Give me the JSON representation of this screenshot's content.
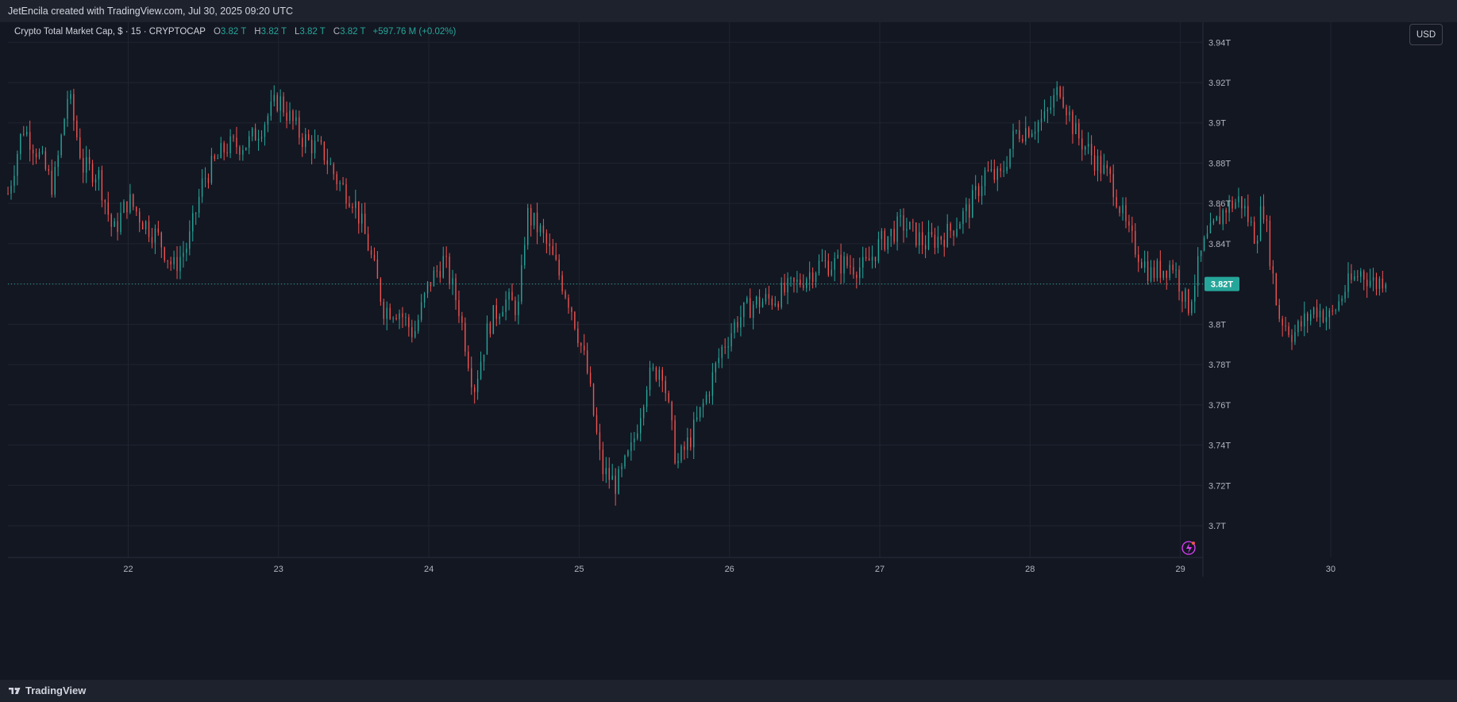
{
  "header": {
    "credit": "JetEncila created with TradingView.com, Jul 30, 2025 09:20 UTC"
  },
  "legend": {
    "symbol": "Crypto Total Market Cap, $ · 15 · CRYPTOCAP",
    "open_label": "O",
    "open": "3.82 T",
    "high_label": "H",
    "high": "3.82 T",
    "low_label": "L",
    "low": "3.82 T",
    "close_label": "C",
    "close": "3.82 T",
    "change": "+597.76 M (+0.02%)"
  },
  "toolbar": {
    "currency": "USD"
  },
  "footer": {
    "brand": "TradingView"
  },
  "icons": {
    "brand_logo": "tradingview-logo-icon",
    "replay": "lightning-icon"
  },
  "colors": {
    "up": "#26a69a",
    "down": "#ef5350",
    "background": "#131722",
    "price_label": "#26a69a",
    "grid": "#1f2430"
  },
  "chart_data": {
    "type": "candlestick",
    "title": "Crypto Total Market Cap",
    "interval": "15",
    "exchange": "CRYPTOCAP",
    "unit": "T",
    "x_ticks": [
      "22",
      "23",
      "24",
      "25",
      "26",
      "27",
      "28",
      "29",
      "30"
    ],
    "y_ticks": [
      3.7,
      3.72,
      3.74,
      3.76,
      3.78,
      3.8,
      3.82,
      3.84,
      3.86,
      3.88,
      3.9,
      3.92,
      3.94
    ],
    "y_tick_labels": [
      "3.7T",
      "3.72T",
      "3.74T",
      "3.76T",
      "3.78T",
      "3.8T",
      "3.82T",
      "3.84T",
      "3.86T",
      "3.88T",
      "3.9T",
      "3.92T",
      "3.94T"
    ],
    "ylim": [
      3.685,
      3.945
    ],
    "xlim_days": [
      21.2,
      30.5
    ],
    "current_price": 3.82,
    "current_price_label": "3.82T",
    "grid": true,
    "series_path": [
      [
        21.2,
        3.865
      ],
      [
        21.3,
        3.898
      ],
      [
        21.4,
        3.885
      ],
      [
        21.5,
        3.868
      ],
      [
        21.55,
        3.89
      ],
      [
        21.6,
        3.915
      ],
      [
        21.7,
        3.878
      ],
      [
        21.8,
        3.875
      ],
      [
        21.9,
        3.845
      ],
      [
        22.0,
        3.862
      ],
      [
        22.1,
        3.851
      ],
      [
        22.2,
        3.843
      ],
      [
        22.3,
        3.828
      ],
      [
        22.4,
        3.84
      ],
      [
        22.5,
        3.872
      ],
      [
        22.65,
        3.888
      ],
      [
        22.8,
        3.89
      ],
      [
        22.9,
        3.9
      ],
      [
        23.0,
        3.912
      ],
      [
        23.15,
        3.893
      ],
      [
        23.3,
        3.885
      ],
      [
        23.4,
        3.87
      ],
      [
        23.5,
        3.862
      ],
      [
        23.6,
        3.838
      ],
      [
        23.7,
        3.808
      ],
      [
        23.8,
        3.807
      ],
      [
        23.9,
        3.795
      ],
      [
        24.0,
        3.82
      ],
      [
        24.1,
        3.832
      ],
      [
        24.2,
        3.808
      ],
      [
        24.3,
        3.768
      ],
      [
        24.4,
        3.8
      ],
      [
        24.5,
        3.812
      ],
      [
        24.6,
        3.808
      ],
      [
        24.65,
        3.855
      ],
      [
        24.75,
        3.845
      ],
      [
        24.85,
        3.828
      ],
      [
        24.95,
        3.808
      ],
      [
        25.05,
        3.778
      ],
      [
        25.15,
        3.728
      ],
      [
        25.25,
        3.72
      ],
      [
        25.35,
        3.738
      ],
      [
        25.45,
        3.772
      ],
      [
        25.55,
        3.78
      ],
      [
        25.65,
        3.73
      ],
      [
        25.75,
        3.745
      ],
      [
        25.85,
        3.765
      ],
      [
        25.95,
        3.788
      ],
      [
        26.05,
        3.802
      ],
      [
        26.15,
        3.81
      ],
      [
        26.3,
        3.813
      ],
      [
        26.45,
        3.82
      ],
      [
        26.6,
        3.83
      ],
      [
        26.75,
        3.83
      ],
      [
        26.9,
        3.828
      ],
      [
        27.0,
        3.84
      ],
      [
        27.15,
        3.85
      ],
      [
        27.3,
        3.84
      ],
      [
        27.45,
        3.845
      ],
      [
        27.6,
        3.858
      ],
      [
        27.7,
        3.875
      ],
      [
        27.8,
        3.872
      ],
      [
        27.9,
        3.895
      ],
      [
        28.0,
        3.898
      ],
      [
        28.1,
        3.902
      ],
      [
        28.2,
        3.918
      ],
      [
        28.3,
        3.895
      ],
      [
        28.45,
        3.88
      ],
      [
        28.55,
        3.87
      ],
      [
        28.65,
        3.845
      ],
      [
        28.8,
        3.825
      ],
      [
        28.95,
        3.83
      ],
      [
        29.05,
        3.808
      ],
      [
        29.15,
        3.838
      ],
      [
        29.3,
        3.858
      ],
      [
        29.4,
        3.862
      ],
      [
        29.5,
        3.843
      ],
      [
        29.55,
        3.86
      ],
      [
        29.65,
        3.805
      ],
      [
        29.75,
        3.795
      ],
      [
        29.9,
        3.808
      ],
      [
        30.0,
        3.803
      ],
      [
        30.1,
        3.818
      ],
      [
        30.2,
        3.826
      ],
      [
        30.3,
        3.82
      ],
      [
        30.4,
        3.826
      ],
      [
        30.5,
        3.82
      ]
    ]
  }
}
